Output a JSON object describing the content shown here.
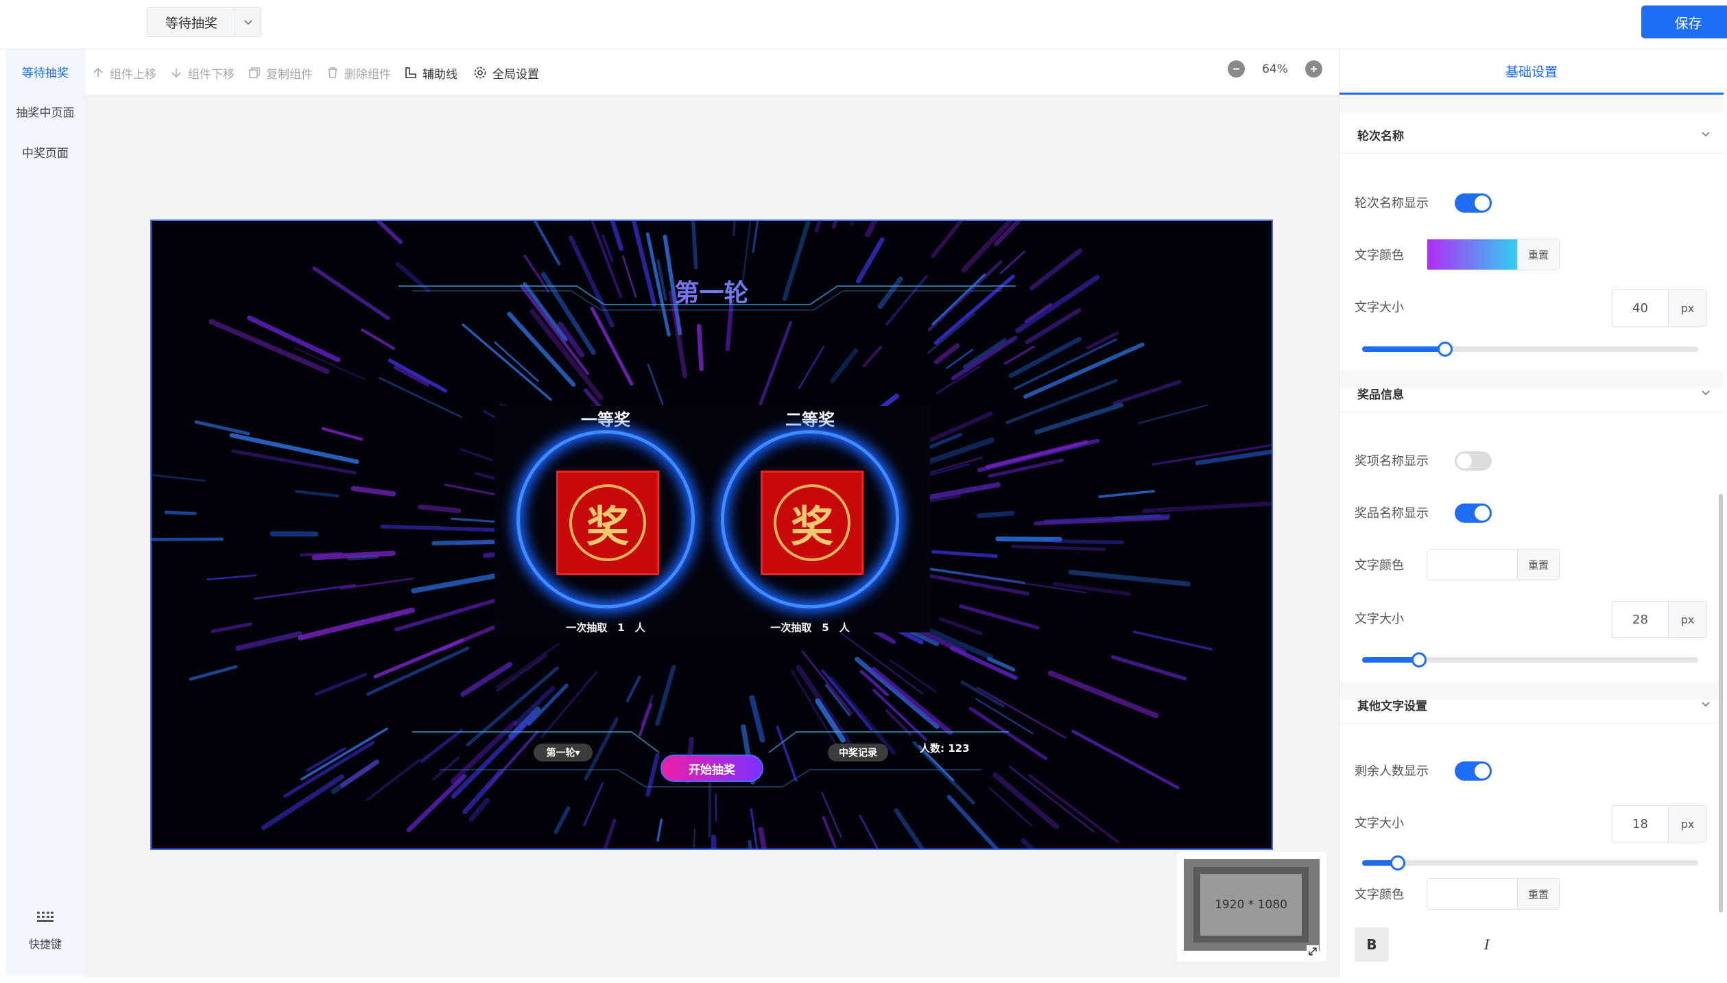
{
  "topbar": {
    "page_select": "等待抽奖",
    "save_label": "保存"
  },
  "leftnav": {
    "items": [
      {
        "label": "等待抽奖",
        "active": true
      },
      {
        "label": "抽奖中页面",
        "active": false
      },
      {
        "label": "中奖页面",
        "active": false
      }
    ],
    "shortcut_label": "快捷键"
  },
  "toolbar": {
    "move_up": "组件上移",
    "move_down": "组件下移",
    "copy": "复制组件",
    "delete": "删除组件",
    "guides": "辅助线",
    "global": "全局设置",
    "zoom": "64%"
  },
  "stage": {
    "round_title": "第一轮",
    "prizes": [
      {
        "name": "一等奖",
        "draw_text": "一次抽取　1　人"
      },
      {
        "name": "二等奖",
        "draw_text": "一次抽取　5　人"
      }
    ],
    "prize_char": "奖",
    "round_pill": "第一轮▾",
    "start_label": "开始抽奖",
    "record_label": "中奖记录",
    "count_text": "人数: 123",
    "minimap_size": "1920 * 1080"
  },
  "panel": {
    "tab": "基础设置",
    "sections": [
      {
        "title": "轮次名称"
      },
      {
        "title": "奖品信息"
      },
      {
        "title": "其他文字设置"
      }
    ],
    "round_name_show": {
      "label": "轮次名称显示",
      "on": true
    },
    "round_text_color": {
      "label": "文字颜色",
      "reset": "重置",
      "gradient_from": "#b22cf5",
      "gradient_to": "#2fd0f0"
    },
    "round_text_size": {
      "label": "文字大小",
      "value": "40",
      "unit": "px",
      "fraction": 0.246
    },
    "prize_item_show": {
      "label": "奖项名称显示",
      "on": false
    },
    "prize_name_show": {
      "label": "奖品名称显示",
      "on": true
    },
    "prize_text_color": {
      "label": "文字颜色",
      "reset": "重置",
      "color": "#ffffff"
    },
    "prize_text_size": {
      "label": "文字大小",
      "value": "28",
      "unit": "px",
      "fraction": 0.169
    },
    "remaining_show": {
      "label": "剩余人数显示",
      "on": true
    },
    "other_text_size": {
      "label": "文字大小",
      "value": "18",
      "unit": "px",
      "fraction": 0.106
    },
    "other_text_color": {
      "label": "文字颜色",
      "reset": "重置",
      "color": "#ffffff"
    },
    "bold_label": "B",
    "italic_label": "I"
  },
  "colors": {
    "accent": "#1d6ef5"
  }
}
